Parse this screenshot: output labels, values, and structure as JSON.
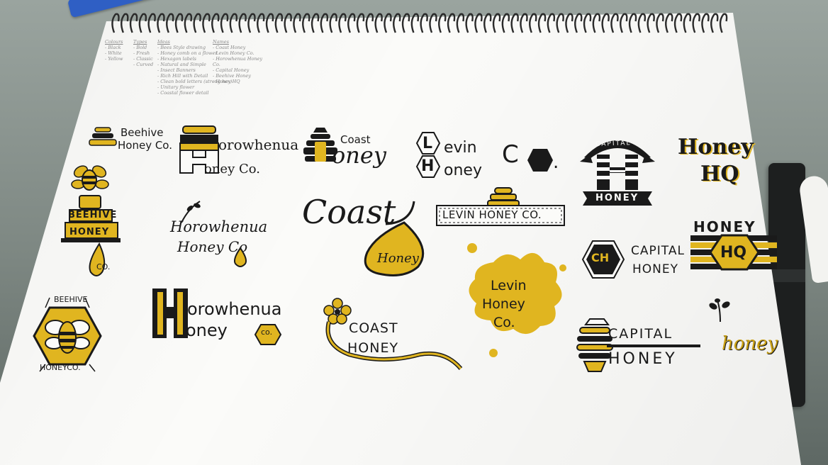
{
  "colors": {
    "ink": "#1a1a1a",
    "honey_yellow": "#e0b520",
    "paper": "#fbfbf9",
    "pencil": "#8a8a8a"
  },
  "objects": [
    "blue-pen",
    "black-marker",
    "white-marker",
    "spiral-sketchbook"
  ],
  "notes": {
    "colours": {
      "title": "Colours",
      "items": [
        "- Black",
        "- White",
        "- Yellow"
      ]
    },
    "types": {
      "title": "Types",
      "items": [
        "- Bold",
        "- Fresh",
        "- Classic",
        "- Curved"
      ]
    },
    "ideas": {
      "title": "Ideas",
      "items": [
        "- Bees Style drawing",
        "- Honey comb on a flower",
        "- Hexagon labels",
        "- Natural and Simple",
        "- Insect Banners",
        "- Rich Hill with Detail",
        "- Clean bold letters (strong hex)",
        "- Unitary flower",
        "- Coastal flower detail"
      ]
    },
    "names": {
      "title": "Names",
      "items": [
        "- Coast Honey",
        "- Levin Honey Co.",
        "- Horowhenua Honey Co.",
        "- Capital Honey",
        "- Beehive Honey",
        "- Honey HQ"
      ]
    }
  },
  "logos": {
    "beehive_1": {
      "line1": "Beehive",
      "line2": "Honey Co."
    },
    "horowhenua_1": {
      "initial": "H",
      "line1": "orowhenua",
      "line2": "oney Co."
    },
    "coast_1": {
      "line1": "Coast",
      "line2": "oney"
    },
    "levin_1": {
      "l": "L",
      "h": "H",
      "line1": "evin",
      "line2": "oney",
      "co": "C",
      "dot": "."
    },
    "capital_1": {
      "arch": "CAPITAL",
      "banner": "HONEY",
      "initial": "H"
    },
    "honeyhq_1": {
      "line1": "Honey",
      "line2": "HQ"
    },
    "beehive_2": {
      "line1": "BEEHIVE",
      "line2": "HONEY",
      "drop": "CO."
    },
    "horowhenua_2": {
      "line1": "Horowhenua",
      "line2": "Honey Co"
    },
    "coast_2": {
      "word": "Coast",
      "drop": "Honey"
    },
    "levin_2": {
      "banner": "LEVIN HONEY CO."
    },
    "capital_2": {
      "badge": "CH",
      "line1": "CAPITAL",
      "line2": "HONEY"
    },
    "honeyhq_2": {
      "line1": "HONEY",
      "badge": "HQ"
    },
    "beehive_3": {
      "top": "BEEHIVE",
      "bottom": "HONEYCO."
    },
    "horowhenua_3": {
      "initial": "H",
      "line1": "orowhenua",
      "line2": "oney",
      "co": "co."
    },
    "coast_3": {
      "line1": "COAST",
      "line2": "HONEY"
    },
    "levin_3": {
      "line1": "Levin",
      "line2": "Honey",
      "line3": "Co."
    },
    "capital_3": {
      "line1": "CAPITAL",
      "line2": "HONEY"
    },
    "honey_3": {
      "word": "honey"
    }
  }
}
